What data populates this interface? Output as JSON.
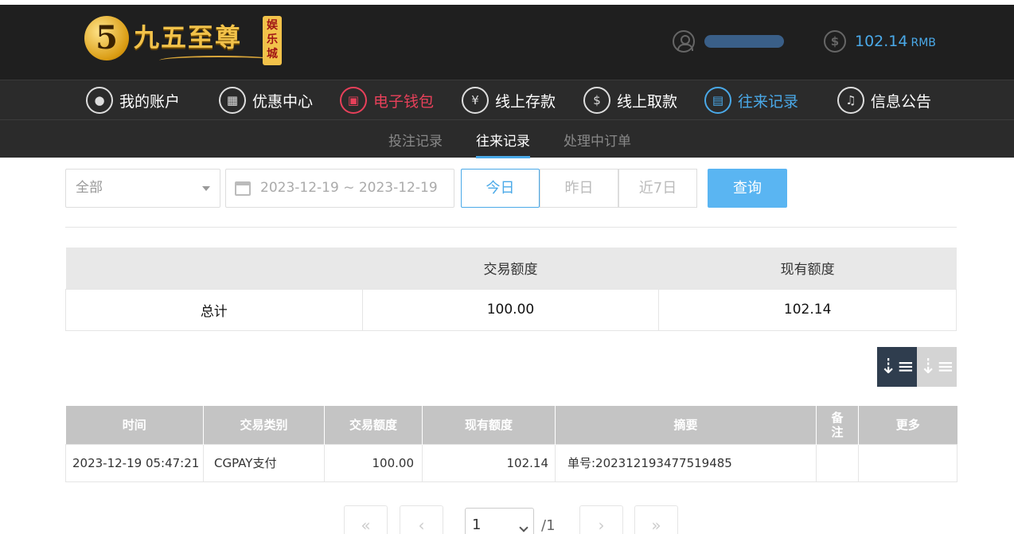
{
  "header": {
    "logo_text": "九五至尊",
    "logo_badge": "娱乐城",
    "balance": "102.14",
    "currency": "RMB"
  },
  "main_nav": [
    {
      "label": "我的账户",
      "icon": "user-icon"
    },
    {
      "label": "优惠中心",
      "icon": "gift-icon"
    },
    {
      "label": "电子钱包",
      "icon": "wallet-icon"
    },
    {
      "label": "线上存款",
      "icon": "deposit-icon"
    },
    {
      "label": "线上取款",
      "icon": "withdraw-icon"
    },
    {
      "label": "往来记录",
      "icon": "records-icon"
    },
    {
      "label": "信息公告",
      "icon": "bell-icon"
    }
  ],
  "sub_nav": {
    "items": [
      "投注记录",
      "往来记录",
      "处理中订单"
    ],
    "active": "往来记录"
  },
  "filters": {
    "type_value": "全部",
    "date_range": "2023-12-19 ~ 2023-12-19",
    "quick": [
      "今日",
      "昨日",
      "近7日"
    ],
    "quick_active": "今日",
    "query_label": "查询"
  },
  "summary": {
    "headers": [
      "",
      "交易额度",
      "现有额度"
    ],
    "row": {
      "label": "总计",
      "amount": "100.00",
      "balance": "102.14"
    }
  },
  "records": {
    "headers": [
      "时间",
      "交易类别",
      "交易额度",
      "现有额度",
      "摘要",
      "备注",
      "更多"
    ],
    "rows": [
      {
        "time": "2023-12-19 05:47:21",
        "type": "CGPAY支付",
        "amount": "100.00",
        "balance": "102.14",
        "summary": "单号:202312193477519485",
        "note": "",
        "more": ""
      }
    ]
  },
  "pagination": {
    "current": "1",
    "total": "/1"
  },
  "colors": {
    "accent_blue": "#4aa9e8",
    "accent_red": "#e8405a",
    "header_bg": "#1f1f1f"
  }
}
